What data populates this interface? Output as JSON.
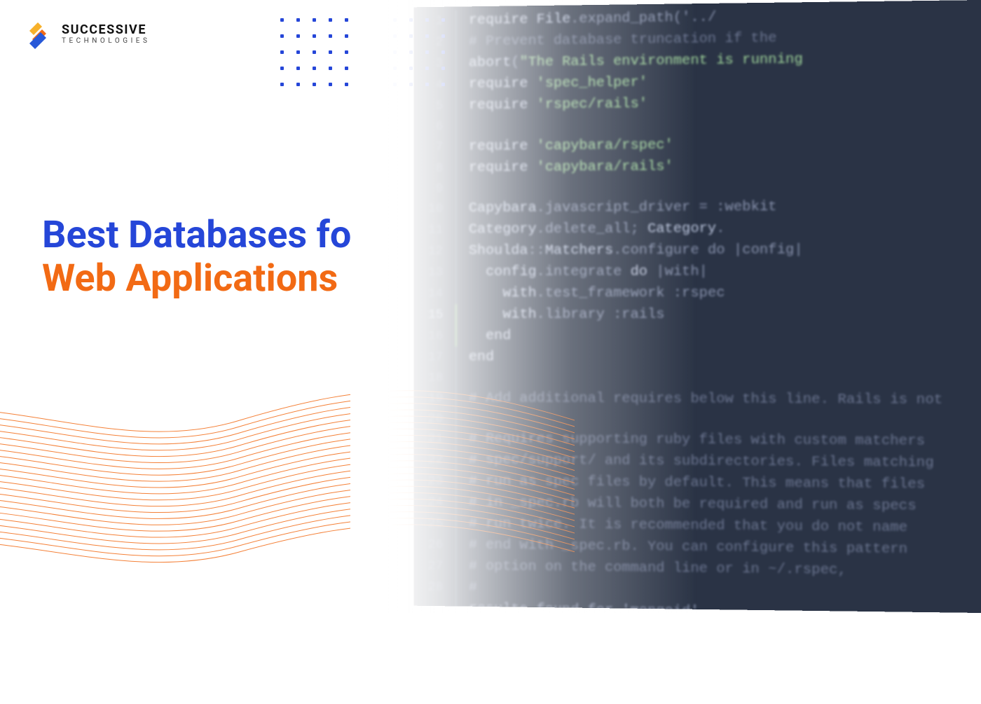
{
  "brand": {
    "name_line1": "SUCCESSIVE",
    "name_line2": "TECHNOLOGIES"
  },
  "headline": {
    "line1": "Best Databases for",
    "line2": "Web Applications"
  },
  "colors": {
    "blue": "#2546d8",
    "orange": "#f26a14",
    "code_bg": "#2a3345"
  },
  "dot_grid": {
    "rows": 5,
    "cols": 11
  },
  "code_lines": [
    {
      "n": "1",
      "indent": 0,
      "segments": [
        {
          "c": "kw",
          "t": "require "
        },
        {
          "c": "id",
          "t": "File"
        },
        {
          "c": "dim",
          "t": ".expand_path('../"
        },
        {
          "c": "dim",
          "t": ""
        }
      ]
    },
    {
      "n": "2",
      "indent": 0,
      "segments": [
        {
          "c": "cmt",
          "t": "# Prevent database truncation if the"
        }
      ]
    },
    {
      "n": "3",
      "indent": 0,
      "segments": [
        {
          "c": "id",
          "t": "abort"
        },
        {
          "c": "dim",
          "t": "("
        },
        {
          "c": "str",
          "t": "\"The Rails environment is running"
        },
        {
          "c": "dim",
          "t": ""
        }
      ]
    },
    {
      "n": "4",
      "indent": 0,
      "segments": [
        {
          "c": "kw",
          "t": "require "
        },
        {
          "c": "str",
          "t": "'spec_helper'"
        }
      ]
    },
    {
      "n": "5",
      "indent": 0,
      "segments": [
        {
          "c": "kw",
          "t": "require "
        },
        {
          "c": "str",
          "t": "'rspec/rails'"
        }
      ]
    },
    {
      "n": "6",
      "indent": 0,
      "segments": [
        {
          "c": "dim",
          "t": ""
        }
      ]
    },
    {
      "n": "7",
      "indent": 0,
      "segments": [
        {
          "c": "kw",
          "t": "require "
        },
        {
          "c": "str",
          "t": "'capybara/rspec'"
        }
      ]
    },
    {
      "n": "8",
      "indent": 0,
      "segments": [
        {
          "c": "kw",
          "t": "require "
        },
        {
          "c": "str",
          "t": "'capybara/rails'"
        }
      ]
    },
    {
      "n": "9",
      "indent": 0,
      "segments": [
        {
          "c": "dim",
          "t": ""
        }
      ]
    },
    {
      "n": "10",
      "indent": 0,
      "segments": [
        {
          "c": "id",
          "t": "Capybara"
        },
        {
          "c": "dim",
          "t": ".javascript_driver = "
        },
        {
          "c": "dim",
          "t": ":webkit"
        }
      ]
    },
    {
      "n": "11",
      "indent": 0,
      "segments": [
        {
          "c": "id",
          "t": "Category"
        },
        {
          "c": "dim",
          "t": ".delete_all; "
        },
        {
          "c": "id",
          "t": "Category"
        },
        {
          "c": "dim",
          "t": "."
        }
      ]
    },
    {
      "n": "12",
      "indent": 0,
      "segments": [
        {
          "c": "id",
          "t": "Shoulda"
        },
        {
          "c": "dim",
          "t": "::"
        },
        {
          "c": "id",
          "t": "Matchers"
        },
        {
          "c": "dim",
          "t": ".configure do |config|"
        }
      ]
    },
    {
      "n": "13",
      "indent": 1,
      "segments": [
        {
          "c": "id",
          "t": "config"
        },
        {
          "c": "dim",
          "t": ".integrate "
        },
        {
          "c": "kw",
          "t": "do"
        },
        {
          "c": "dim",
          "t": " |with|"
        }
      ]
    },
    {
      "n": "14",
      "indent": 2,
      "segments": [
        {
          "c": "id",
          "t": "with"
        },
        {
          "c": "dim",
          "t": ".test_framework "
        },
        {
          "c": "dim",
          "t": ":rspec"
        }
      ]
    },
    {
      "n": "15",
      "indent": 2,
      "g": "green",
      "current": true,
      "segments": [
        {
          "c": "id",
          "t": "with"
        },
        {
          "c": "dim",
          "t": ".library "
        },
        {
          "c": "dim",
          "t": ":rails"
        }
      ]
    },
    {
      "n": "16",
      "indent": 1,
      "g": "green",
      "segments": [
        {
          "c": "kw",
          "t": "end"
        }
      ]
    },
    {
      "n": "17",
      "indent": 0,
      "segments": [
        {
          "c": "kw",
          "t": "end"
        }
      ]
    },
    {
      "n": "18",
      "indent": 0,
      "segments": [
        {
          "c": "dim",
          "t": ""
        }
      ]
    },
    {
      "n": "19",
      "indent": 0,
      "segments": [
        {
          "c": "cmt",
          "t": "# Add additional requires below this line. Rails is not"
        }
      ]
    },
    {
      "n": "20",
      "indent": 0,
      "segments": [
        {
          "c": "dim",
          "t": ""
        }
      ]
    },
    {
      "n": "21",
      "indent": 0,
      "segments": [
        {
          "c": "cmt",
          "t": "# Requires supporting ruby files with custom matchers"
        }
      ]
    },
    {
      "n": "22",
      "indent": 0,
      "segments": [
        {
          "c": "cmt",
          "t": "# spec/support/ and its subdirectories. Files matching"
        }
      ]
    },
    {
      "n": "23",
      "indent": 0,
      "segments": [
        {
          "c": "cmt",
          "t": "# run as spec files by default. This means that files"
        }
      ]
    },
    {
      "n": "24",
      "indent": 0,
      "segments": [
        {
          "c": "cmt",
          "t": "# in _spec.rb will both be required and run as specs"
        }
      ]
    },
    {
      "n": "25",
      "indent": 0,
      "segments": [
        {
          "c": "cmt",
          "t": "# run twice. It is recommended that you do not name"
        }
      ]
    },
    {
      "n": "26",
      "indent": 0,
      "segments": [
        {
          "c": "cmt",
          "t": "# end with _spec.rb. You can configure this pattern"
        }
      ]
    },
    {
      "n": "27",
      "indent": 0,
      "segments": [
        {
          "c": "cmt",
          "t": "# option on the command line or in ~/.rspec,"
        }
      ]
    },
    {
      "n": "28",
      "indent": 0,
      "segments": [
        {
          "c": "cmt",
          "t": "#"
        }
      ]
    },
    {
      "n": "",
      "indent": 0,
      "segments": [
        {
          "c": "dim",
          "t": "results found for 'mongoid'"
        }
      ]
    }
  ]
}
